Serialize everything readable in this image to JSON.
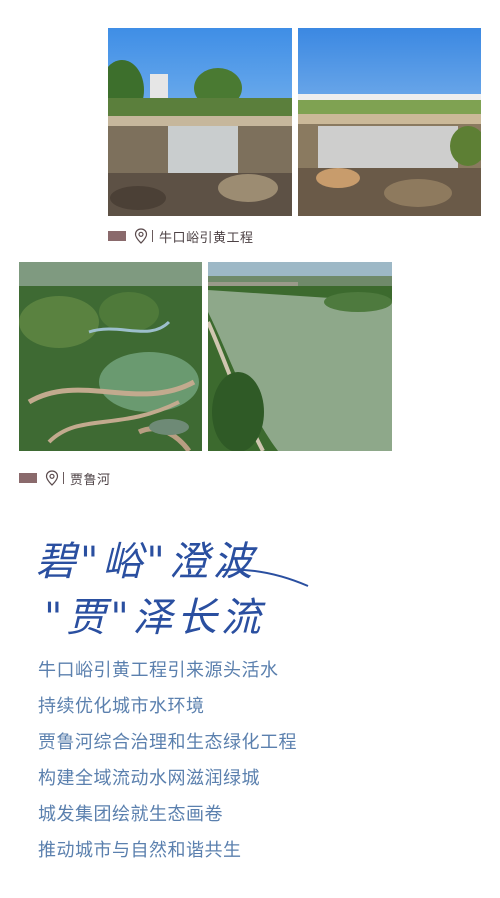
{
  "section1": {
    "photos": [
      {
        "subject": "cascading waterfall over rocks with trees and building"
      },
      {
        "subject": "stepped waterfall with bridge railing above"
      }
    ],
    "caption": {
      "label": "牛口峪引黄工程",
      "icon": "location-pin-icon",
      "swatch_color": "#8a6a6c"
    }
  },
  "section2": {
    "photos": [
      {
        "subject": "aerial view of wetland park with curved boardwalks"
      },
      {
        "subject": "aerial view of wide river with green banks"
      }
    ],
    "caption": {
      "label": "贾鲁河",
      "icon": "location-pin-icon",
      "swatch_color": "#8a6a6c"
    }
  },
  "calligraphy": {
    "line1": "碧\"峪\"澄波",
    "line2": "\"贾\"泽长流"
  },
  "body": {
    "lines": [
      "牛口峪引黄工程引来源头活水",
      "持续优化城市水环境",
      "贾鲁河综合治理和生态绿化工程",
      "构建全域流动水网滋润绿城",
      "城发集团绘就生态画卷",
      "推动城市与自然和谐共生"
    ]
  },
  "colors": {
    "text_blue": "#5b80ae",
    "script_blue": "#2a4fa0",
    "caption_text": "#4d4245"
  }
}
